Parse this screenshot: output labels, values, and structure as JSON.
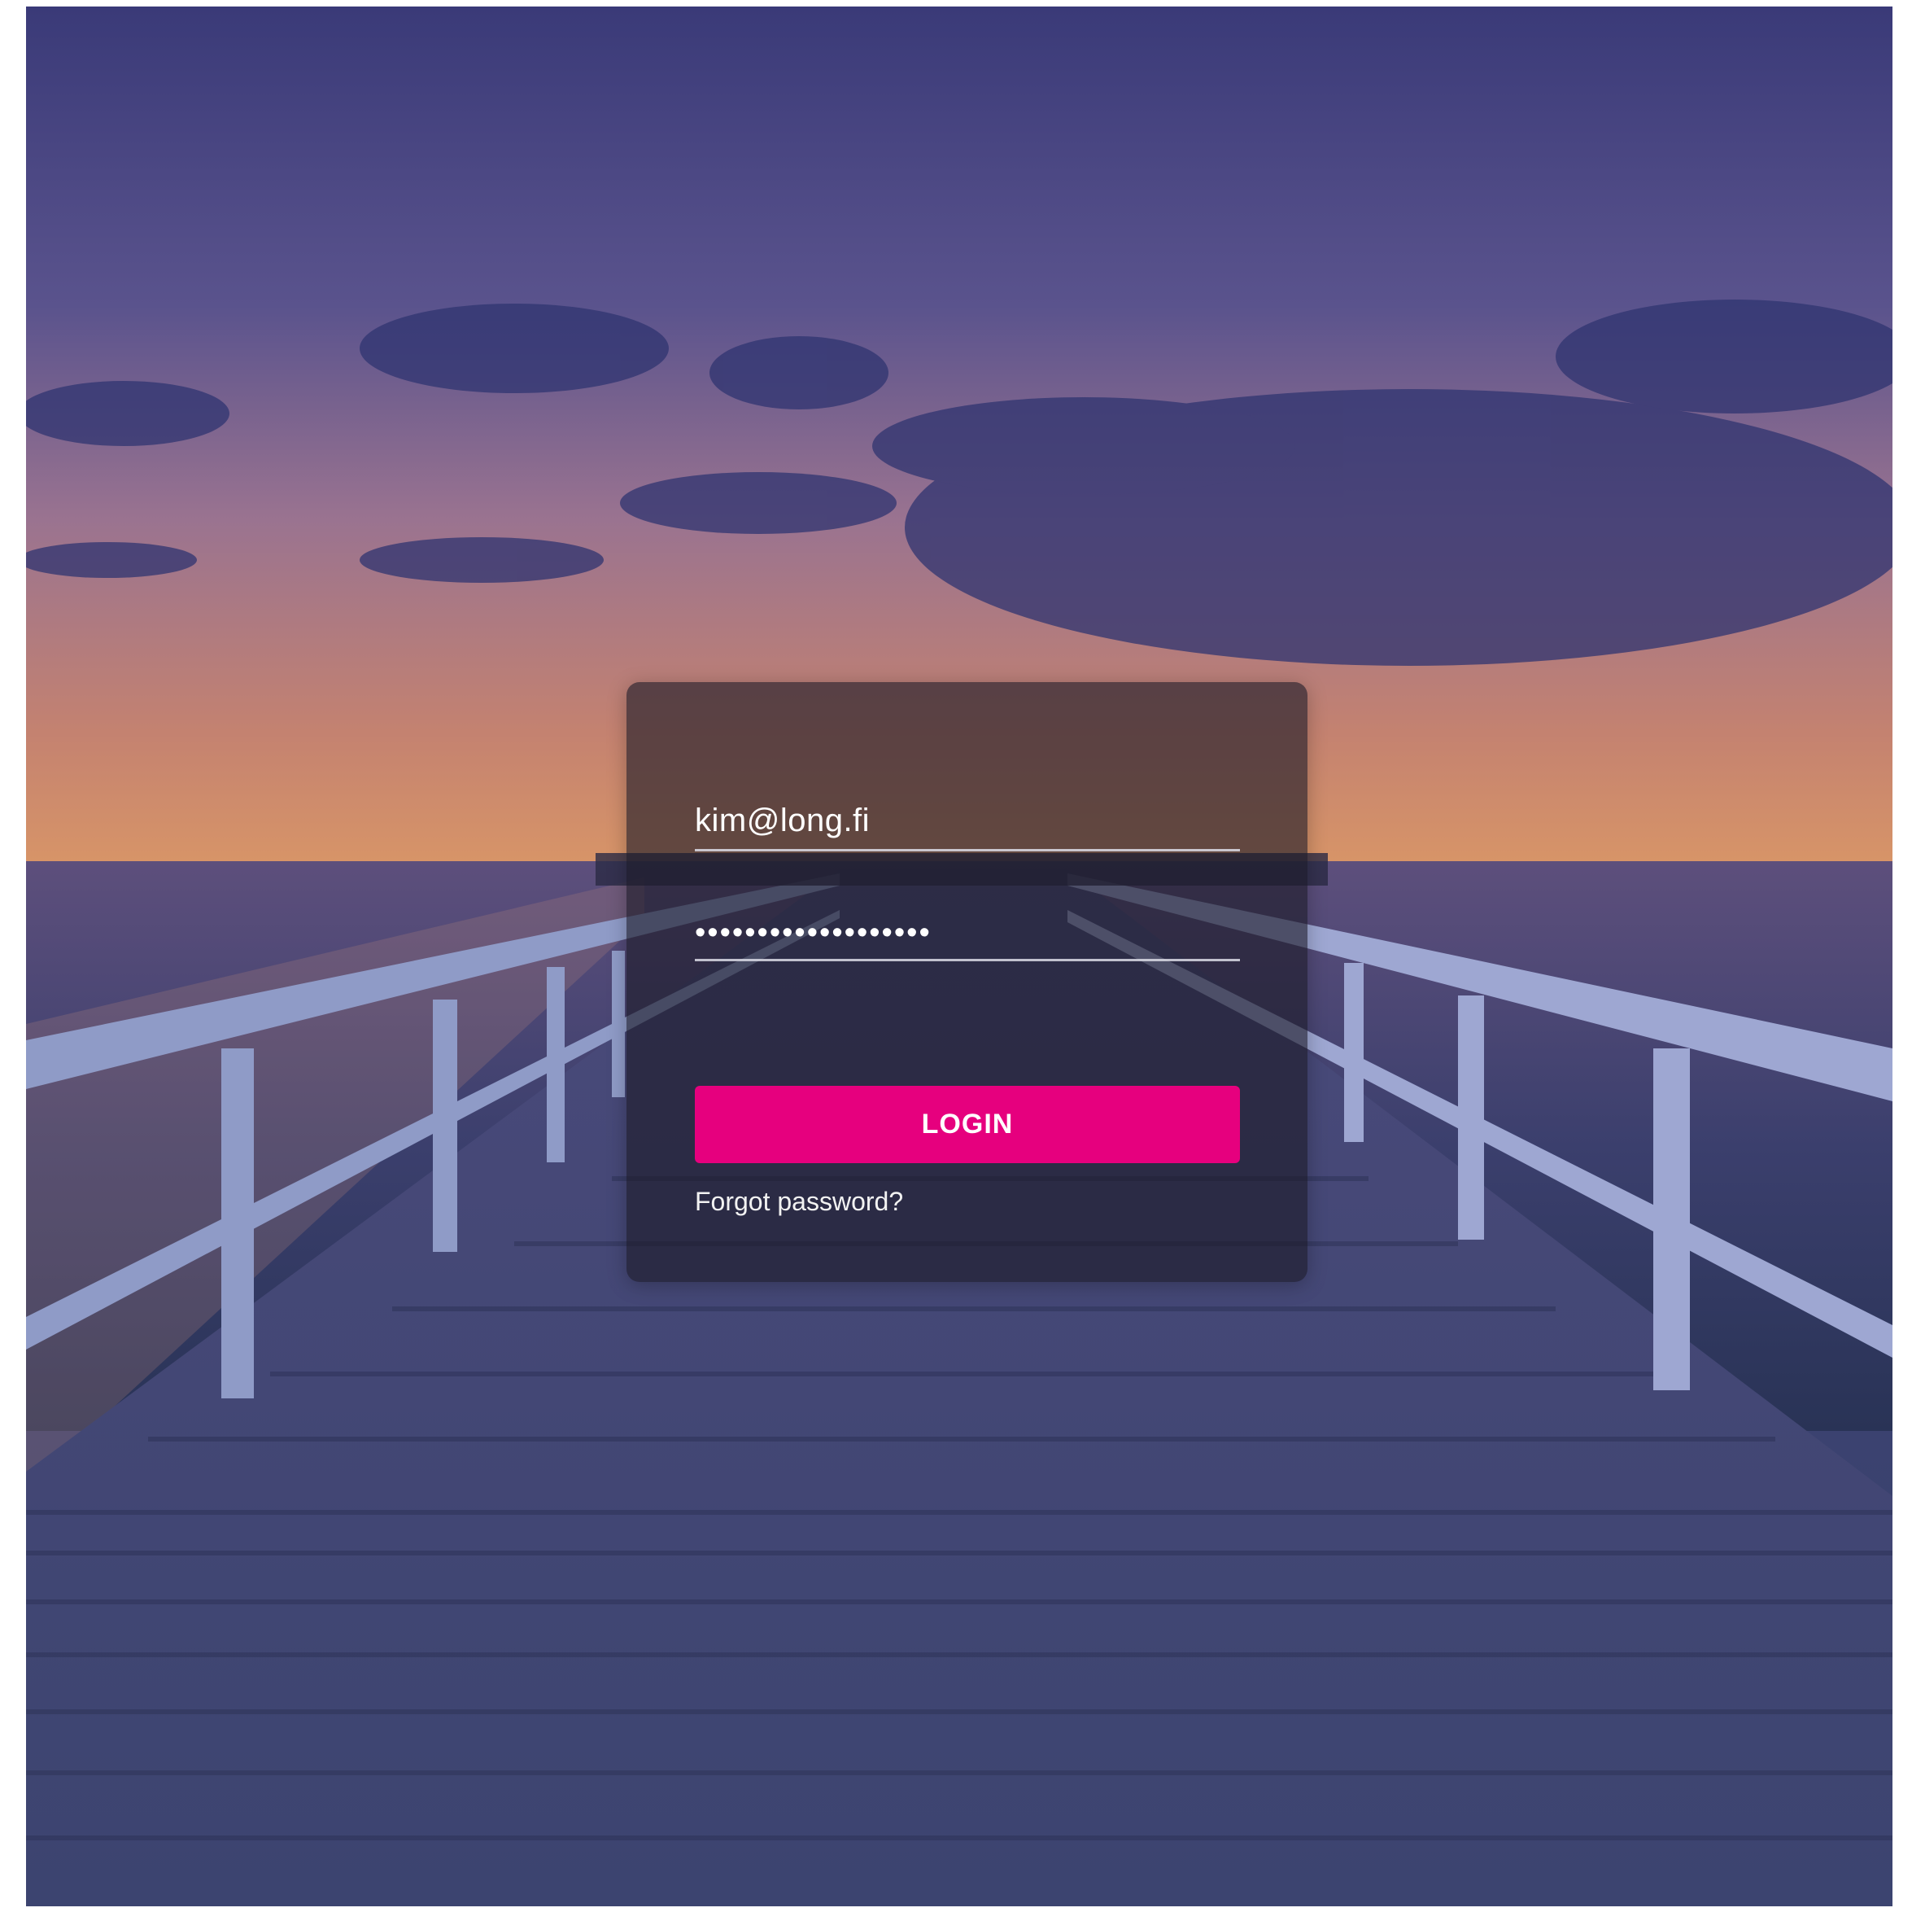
{
  "login_form": {
    "email_value": "kim@long.fi",
    "password_value": "•••••••••••••••••••",
    "login_label": "LOGIN",
    "forgot_password_label": "Forgot password?"
  },
  "colors": {
    "login_button": "#e6007e",
    "card_background": "rgba(28, 26, 38, 0.62)"
  }
}
